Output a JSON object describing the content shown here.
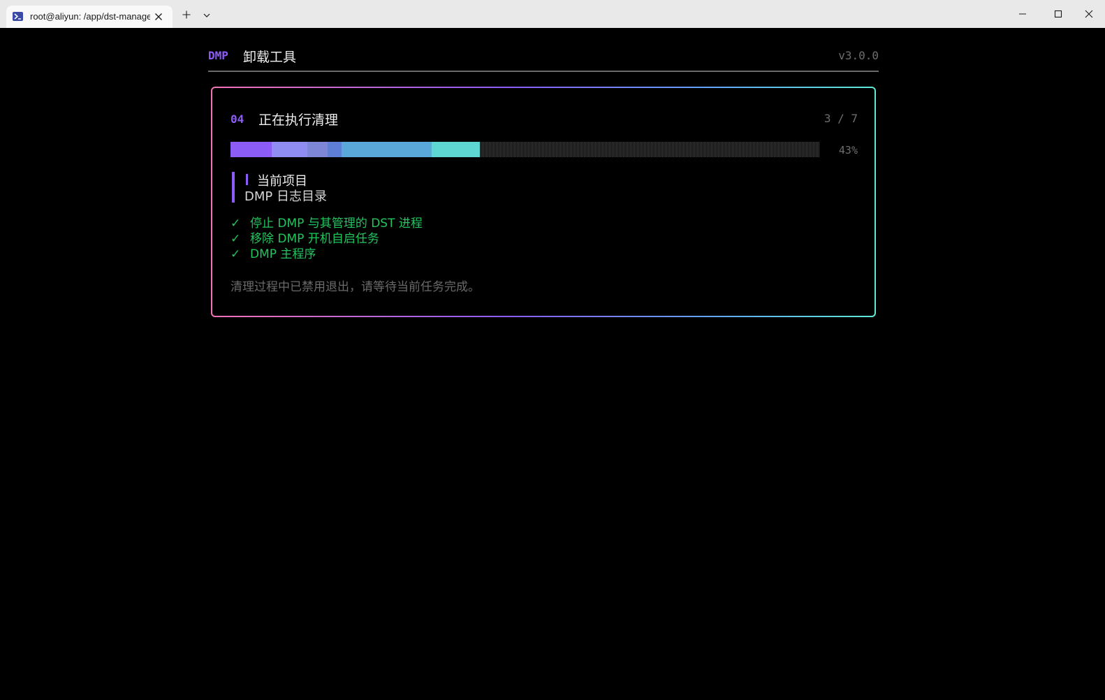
{
  "window": {
    "tab_title": "root@aliyun: /app/dst-manage",
    "tab_icon": "terminal-icon",
    "new_tab_icon": "plus-icon",
    "dropdown_icon": "chevron-down-icon",
    "controls": [
      "minimize-icon",
      "maximize-icon",
      "close-icon"
    ]
  },
  "header": {
    "brand": "DMP",
    "title": "卸载工具",
    "version": "v3.0.0"
  },
  "step": {
    "number": "04",
    "title": "正在执行清理",
    "count": "3 / 7",
    "progress_percent_label": "43%",
    "progress_fraction": 0.43
  },
  "current": {
    "label": "当前项目",
    "value": "DMP 日志目录"
  },
  "completed": [
    {
      "check": "✓",
      "text": "停止 DMP 与其管理的 DST 进程"
    },
    {
      "check": "✓",
      "text": "移除 DMP 开机自启任务"
    },
    {
      "check": "✓",
      "text": "DMP 主程序"
    }
  ],
  "note": "清理过程中已禁用退出，请等待当前任务完成。",
  "colors": {
    "accent": "#8b5cf6",
    "success": "#22c55e",
    "muted": "#6e6e6e",
    "background": "#000000"
  }
}
